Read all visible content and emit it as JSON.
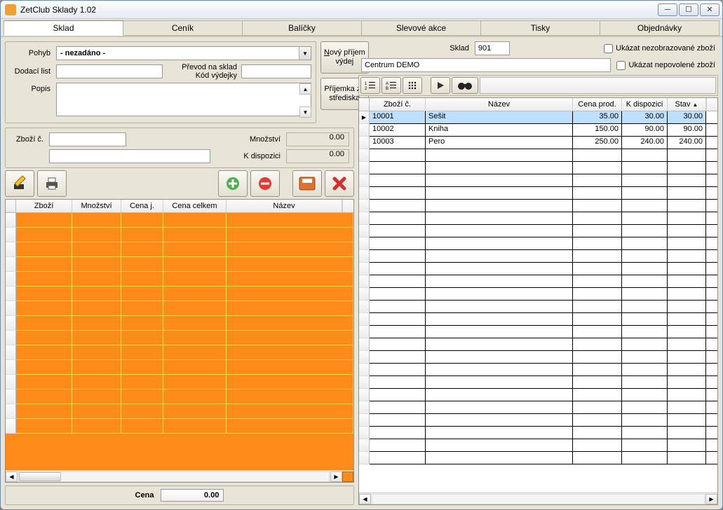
{
  "title": "ZetClub Sklady 1.02",
  "tabs": [
    "Sklad",
    "Ceník",
    "Balíčky",
    "Slevové akce",
    "Tisky",
    "Objednávky"
  ],
  "activeTab": 0,
  "form": {
    "pohyb_label": "Pohyb",
    "pohyb_value": "- nezadáno -",
    "dodaci_list_label": "Dodací list",
    "dodaci_list_value": "",
    "prevod_label": "Převod na sklad",
    "prevod_value": "",
    "kod_vydejky_label": "Kód výdejky",
    "popis_label": "Popis",
    "popis_value": "",
    "button_novy": "Nový příjem výdej",
    "button_prijemka": "Příjemka ze střediska"
  },
  "entry": {
    "zbozi_label": "Zboží č.",
    "zbozi_value": "",
    "name_value": "",
    "mnozstvi_label": "Množství",
    "mnozstvi_value": "0.00",
    "kdisp_label": "K dispozici",
    "kdisp_value": "0.00"
  },
  "grid_left": {
    "cols": [
      "Zboží",
      "Množství",
      "Cena j.",
      "Cena celkem",
      "Název"
    ],
    "widths": [
      80,
      70,
      60,
      90,
      140
    ]
  },
  "footer": {
    "label": "Cena",
    "value": "0.00"
  },
  "right": {
    "sklad_label": "Sklad",
    "sklad_value": "901",
    "centrum": "Centrum DEMO",
    "chk1": "Ukázat nezobrazované zboží",
    "chk2": "Ukázat nepovolené zboží"
  },
  "grid_right": {
    "cols": [
      "Zboží č.",
      "Název",
      "Cena prod.",
      "K dispozici",
      "Stav"
    ],
    "widths": [
      80,
      210,
      70,
      65,
      55
    ],
    "rows": [
      {
        "id": "10001",
        "name": "Sešit",
        "price": "35.00",
        "avail": "30.00",
        "stock": "30.00"
      },
      {
        "id": "10002",
        "name": "Kniha",
        "price": "150.00",
        "avail": "90.00",
        "stock": "90.00"
      },
      {
        "id": "10003",
        "name": "Pero",
        "price": "250.00",
        "avail": "240.00",
        "stock": "240.00"
      }
    ]
  }
}
